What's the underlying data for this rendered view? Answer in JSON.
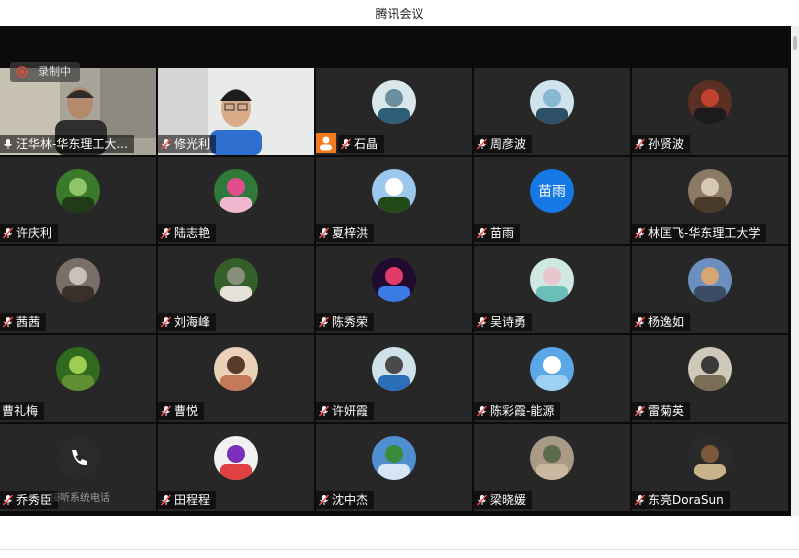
{
  "window": {
    "title": "腾讯会议"
  },
  "recording": {
    "label": "录制中"
  },
  "colors": {
    "accent": "#1678e3",
    "host_badge": "#f07a1e",
    "tile": "#272727"
  },
  "participants": [
    {
      "name": "汪华林-华东理工大...",
      "type": "video",
      "mic": "on"
    },
    {
      "name": "修光利",
      "type": "video",
      "mic": "muted"
    },
    {
      "name": "石晶",
      "type": "avatar",
      "mic": "muted",
      "badge": "person-icon"
    },
    {
      "name": "周彦波",
      "type": "avatar",
      "mic": "muted"
    },
    {
      "name": "孙贤波",
      "type": "avatar",
      "mic": "muted"
    },
    {
      "name": "许庆利",
      "type": "avatar",
      "mic": "muted"
    },
    {
      "name": "陆志艳",
      "type": "avatar",
      "mic": "muted"
    },
    {
      "name": "夏梓洪",
      "type": "avatar",
      "mic": "muted"
    },
    {
      "name": "苗雨",
      "type": "text-avatar",
      "mic": "muted",
      "avatar_text": "苗雨"
    },
    {
      "name": "林匡飞-华东理工大学",
      "type": "avatar",
      "mic": "muted"
    },
    {
      "name": "茜茜",
      "type": "avatar",
      "mic": "muted"
    },
    {
      "name": "刘海峰",
      "type": "avatar",
      "mic": "muted"
    },
    {
      "name": "陈秀荣",
      "type": "avatar",
      "mic": "muted"
    },
    {
      "name": "吴诗勇",
      "type": "avatar",
      "mic": "muted"
    },
    {
      "name": "杨逸如",
      "type": "avatar",
      "mic": "muted"
    },
    {
      "name": "曹礼梅",
      "type": "avatar",
      "mic": "none"
    },
    {
      "name": "曹悦",
      "type": "avatar",
      "mic": "muted"
    },
    {
      "name": "许妍霞",
      "type": "avatar",
      "mic": "muted"
    },
    {
      "name": "陈彩霞-能源",
      "type": "avatar",
      "mic": "muted"
    },
    {
      "name": "雷菊英",
      "type": "avatar",
      "mic": "muted"
    },
    {
      "name": "乔秀臣",
      "type": "phone",
      "mic": "muted",
      "phone_label": "接听系统电话"
    },
    {
      "name": "田程程",
      "type": "avatar",
      "mic": "muted"
    },
    {
      "name": "沈中杰",
      "type": "avatar",
      "mic": "muted"
    },
    {
      "name": "梁晓媛",
      "type": "avatar",
      "mic": "muted"
    },
    {
      "name": "东亮DoraSun",
      "type": "avatar",
      "mic": "muted"
    }
  ]
}
